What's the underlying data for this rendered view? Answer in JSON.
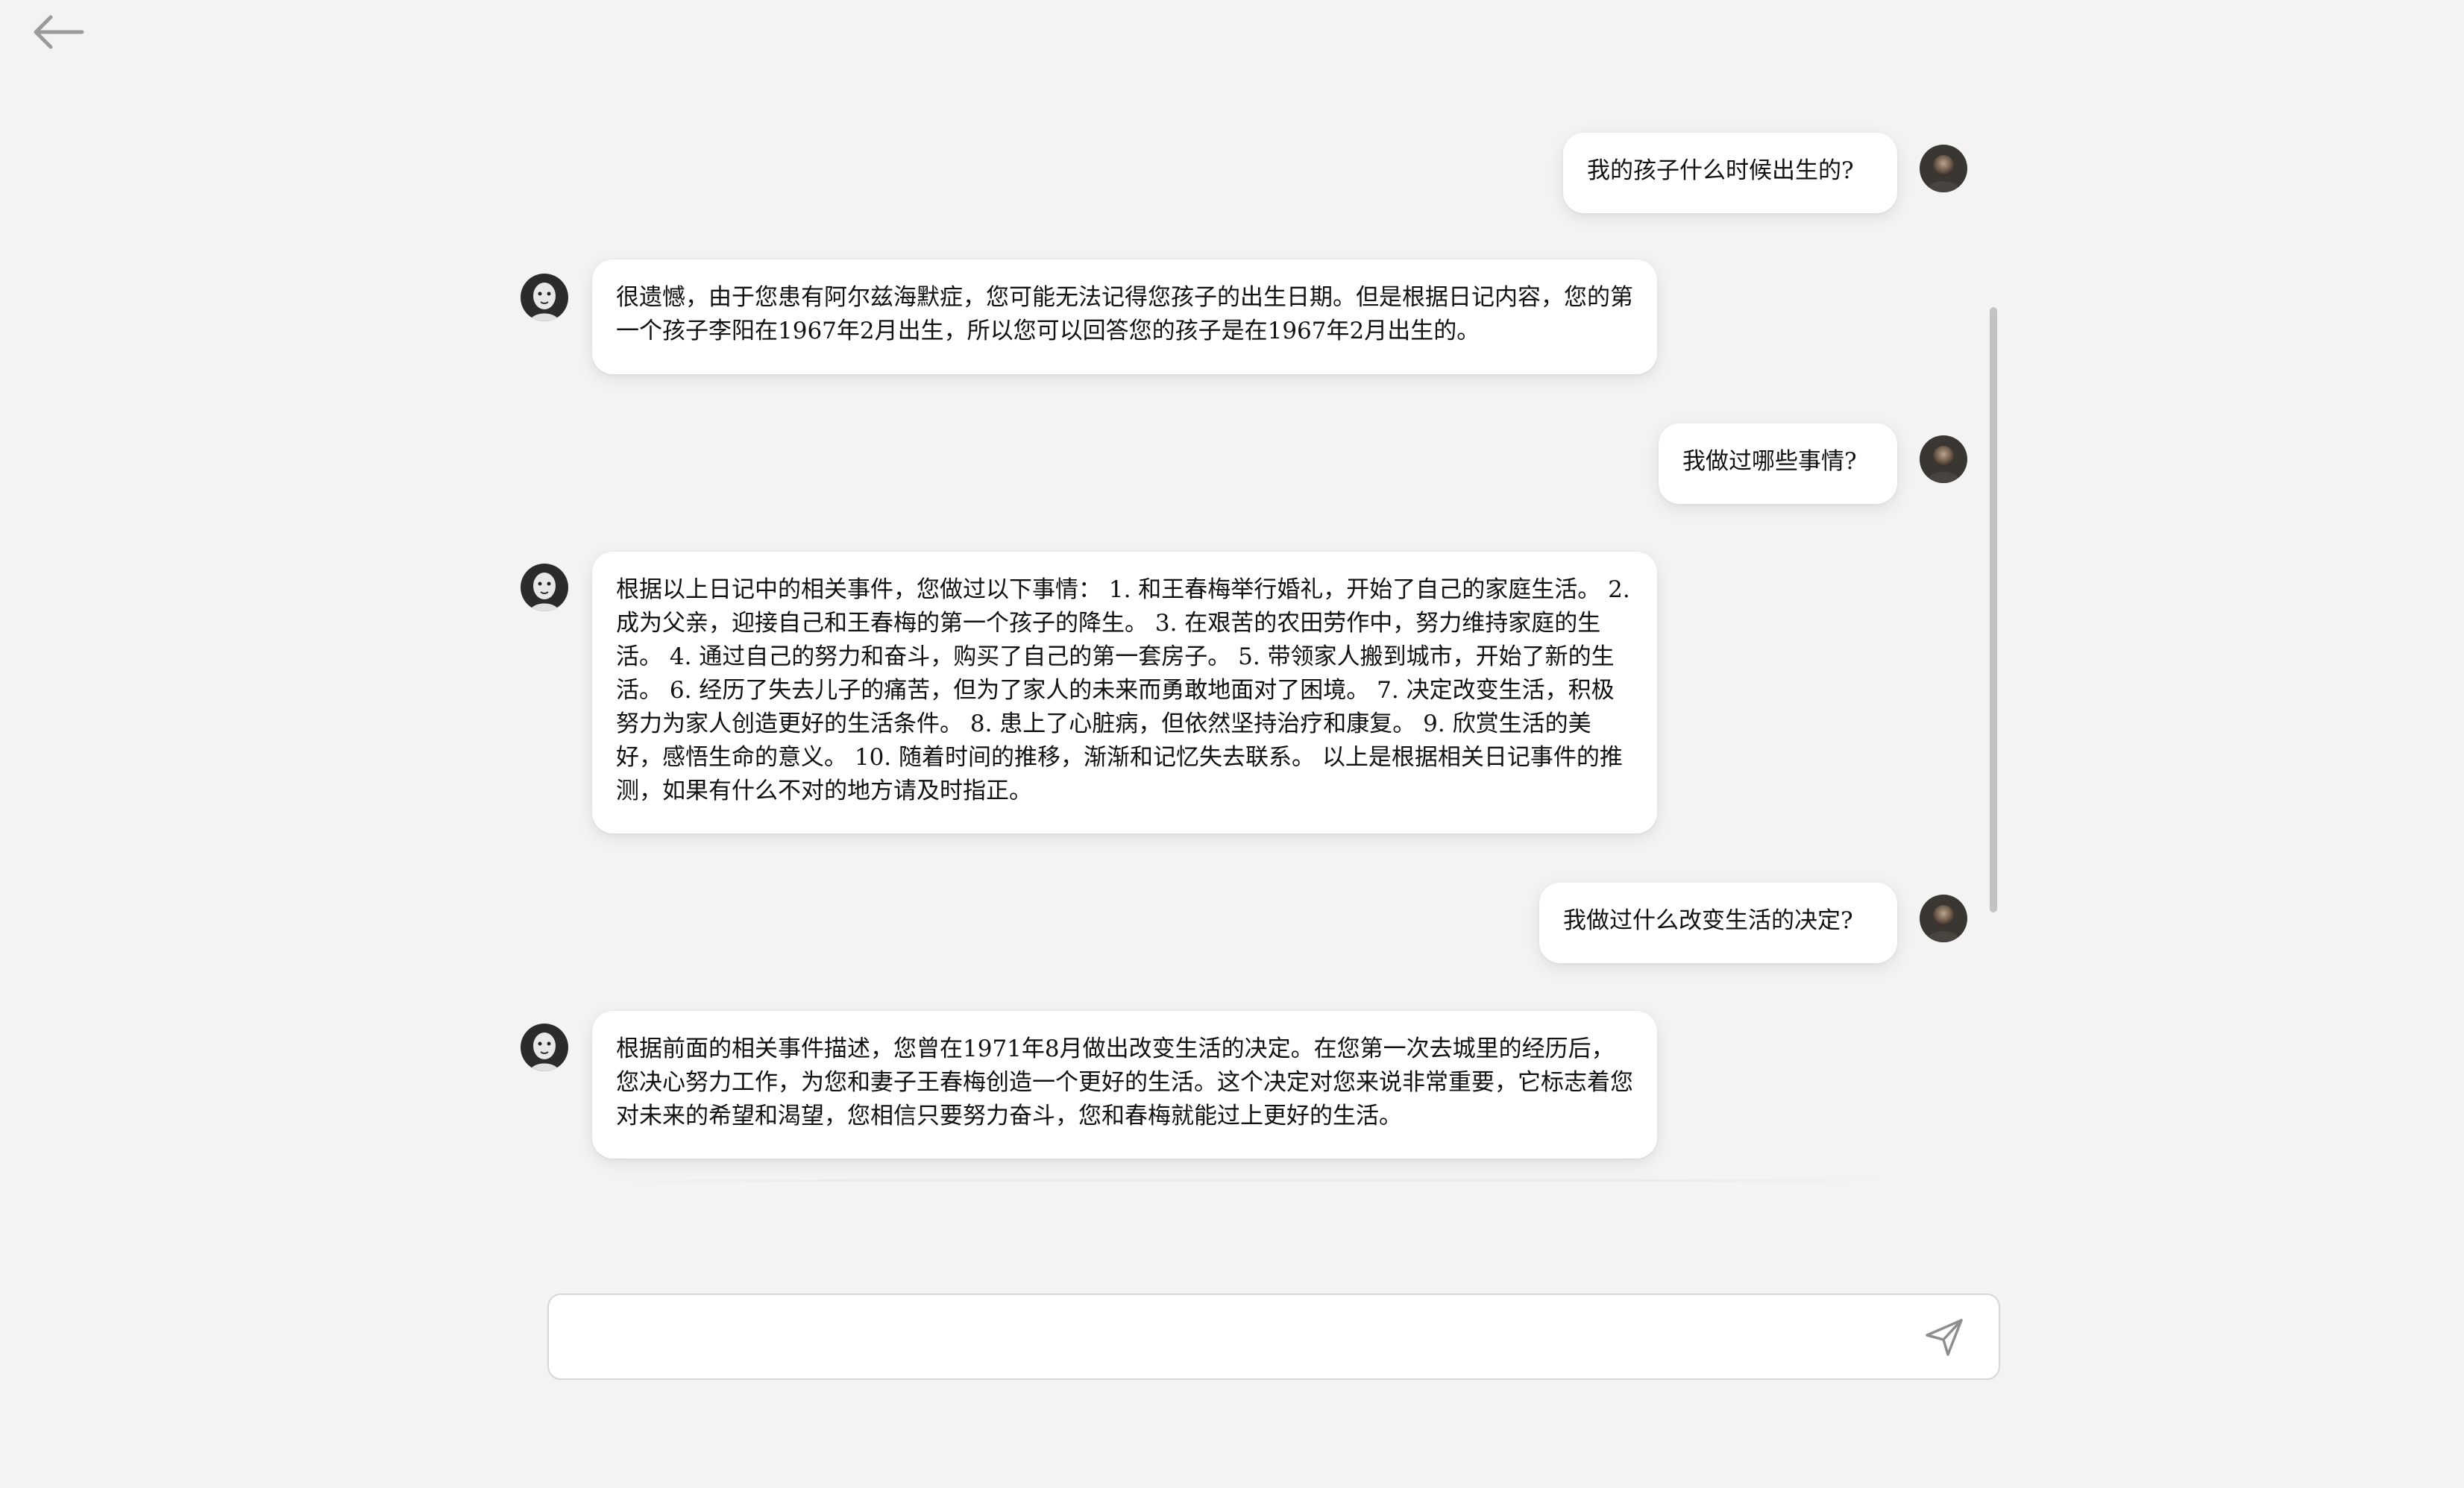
{
  "header": {
    "back_icon": "arrow-left-icon"
  },
  "conversation": [
    {
      "role": "user",
      "text": "我的孩子什么时候出生的?"
    },
    {
      "role": "assistant",
      "text": "很遗憾，由于您患有阿尔兹海默症，您可能无法记得您孩子的出生日期。但是根据日记内容，您的第一个孩子李阳在1967年2月出生，所以您可以回答您的孩子是在1967年2月出生的。"
    },
    {
      "role": "user",
      "text": "我做过哪些事情?"
    },
    {
      "role": "assistant",
      "text": "根据以上日记中的相关事件，您做过以下事情： 1. 和王春梅举行婚礼，开始了自己的家庭生活。 2. 成为父亲，迎接自己和王春梅的第一个孩子的降生。 3. 在艰苦的农田劳作中，努力维持家庭的生活。 4. 通过自己的努力和奋斗，购买了自己的第一套房子。 5. 带领家人搬到城市，开始了新的生活。 6. 经历了失去儿子的痛苦，但为了家人的未来而勇敢地面对了困境。 7. 决定改变生活，积极努力为家人创造更好的生活条件。 8. 患上了心脏病，但依然坚持治疗和康复。 9. 欣赏生活的美好，感悟生命的意义。 10. 随着时间的推移，渐渐和记忆失去联系。 以上是根据相关日记事件的推测，如果有什么不对的地方请及时指正。"
    },
    {
      "role": "user",
      "text": "我做过什么改变生活的决定?"
    },
    {
      "role": "assistant",
      "text": "根据前面的相关事件描述，您曾在1971年8月做出改变生活的决定。在您第一次去城里的经历后，您决心努力工作，为您和妻子王春梅创造一个更好的生活。这个决定对您来说非常重要，它标志着您对未来的希望和渴望，您相信只要努力奋斗，您和春梅就能过上更好的生活。"
    }
  ],
  "composer": {
    "value": "",
    "placeholder": "",
    "send_icon": "send-icon"
  },
  "colors": {
    "background": "#f3f3f3",
    "bubble": "#ffffff",
    "icon_gray": "#9a9a9a"
  }
}
